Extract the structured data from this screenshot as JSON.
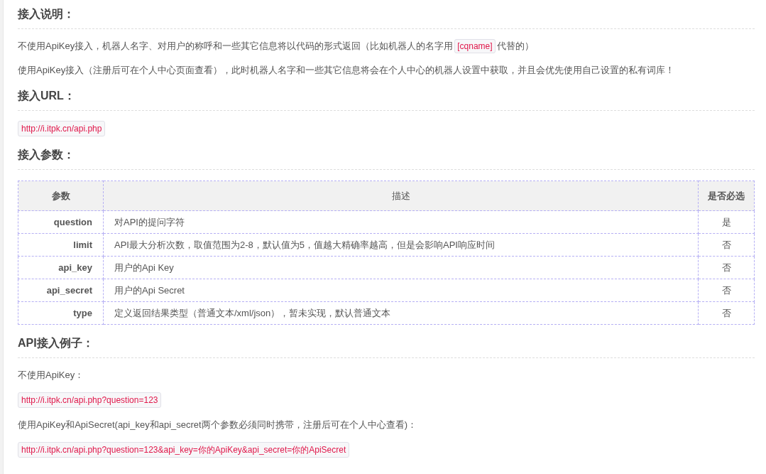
{
  "sections": [
    {
      "heading": "接入说明：",
      "blocks": [
        {
          "kind": "paragraph",
          "segments": [
            {
              "kind": "text",
              "text": "不使用ApiKey接入，机器人名字、对用户的称呼和一些其它信息将以代码的形式返回（比如机器人的名字用"
            },
            {
              "kind": "code",
              "text": "[cqname]"
            },
            {
              "kind": "text",
              "text": "代替的）"
            }
          ]
        },
        {
          "kind": "paragraph",
          "segments": [
            {
              "kind": "text",
              "text": "使用ApiKey接入（注册后可在个人中心页面查看），此时机器人名字和一些其它信息将会在个人中心的机器人设置中获取，并且会优先使用自己设置的私有词库！"
            }
          ]
        }
      ]
    },
    {
      "heading": "接入URL：",
      "blocks": [
        {
          "kind": "code",
          "text": "http://i.itpk.cn/api.php"
        }
      ]
    },
    {
      "heading": "接入参数：",
      "blocks": [
        {
          "kind": "table",
          "columns": [
            "参数",
            "描述",
            "是否必选"
          ],
          "rows": [
            [
              "question",
              "对API的提问字符",
              "是"
            ],
            [
              "limit",
              "API最大分析次数，取值范围为2-8，默认值为5，值越大精确率越高，但是会影响API响应时间",
              "否"
            ],
            [
              "api_key",
              "用户的Api Key",
              "否"
            ],
            [
              "api_secret",
              "用户的Api Secret",
              "否"
            ],
            [
              "type",
              "定义返回结果类型（普通文本/xml/json），暂未实现，默认普通文本",
              "否"
            ]
          ]
        }
      ]
    },
    {
      "heading": "API接入例子：",
      "blocks": [
        {
          "kind": "paragraph",
          "segments": [
            {
              "kind": "text",
              "text": "不使用ApiKey："
            }
          ]
        },
        {
          "kind": "code",
          "text": "http://i.itpk.cn/api.php?question=123"
        },
        {
          "kind": "paragraph",
          "segments": [
            {
              "kind": "text",
              "text": "使用ApiKey和ApiSecret(api_key和api_secret两个参数必须同时携带，注册后可在个人中心查看)："
            }
          ]
        },
        {
          "kind": "code",
          "text": "http://i.itpk.cn/api.php?question=123&api_key=你的ApiKey&api_secret=你的ApiSecret"
        }
      ]
    }
  ]
}
